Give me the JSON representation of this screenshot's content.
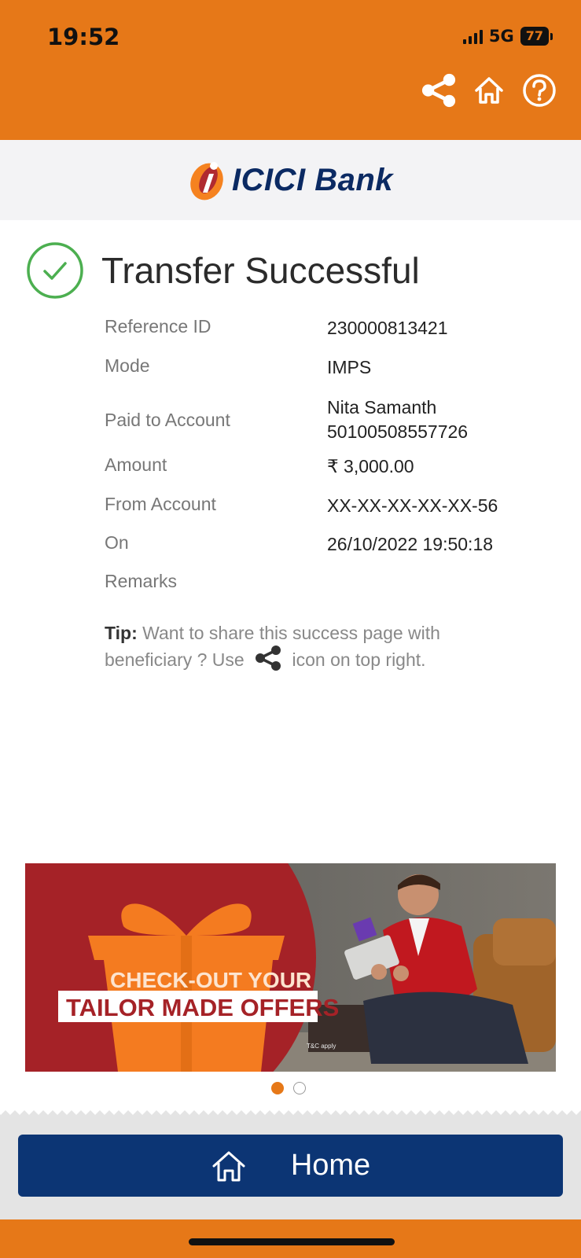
{
  "status_bar": {
    "time": "19:52",
    "network": "5G",
    "battery": "77"
  },
  "header": {
    "icons": [
      "share-icon",
      "home-icon",
      "help-icon"
    ],
    "color": "#e67818"
  },
  "brand": {
    "logo_text": "ICICI Bank",
    "colors": {
      "orange": "#f58220",
      "red": "#b02a30",
      "navy": "#0b2a63"
    }
  },
  "result": {
    "title": "Transfer Successful",
    "icon": "check-circle-icon",
    "color": "#4caf50"
  },
  "details": {
    "reference_id": {
      "label": "Reference ID",
      "value": "230000813421"
    },
    "mode": {
      "label": "Mode",
      "value": "IMPS"
    },
    "paid_to": {
      "label": "Paid to Account",
      "name": "Nita Samanth",
      "account": "50100508557726"
    },
    "amount": {
      "label": "Amount",
      "value": "₹ 3,000.00"
    },
    "from_account": {
      "label": "From Account",
      "value": "XX-XX-XX-XX-XX-56"
    },
    "on": {
      "label": "On",
      "value": "26/10/2022 19:50:18"
    },
    "remarks": {
      "label": "Remarks",
      "value": ""
    }
  },
  "tip": {
    "prefix": "Tip:",
    "text_before": "Want to share this success page with beneficiary ? Use",
    "text_after": "icon on top right."
  },
  "banner": {
    "line1": "CHECK-OUT YOUR",
    "line2": "TAILOR MADE OFFERS",
    "fine_print": "T&C apply",
    "active_page": 1,
    "total_pages": 2
  },
  "bottom": {
    "home_label": "Home"
  }
}
